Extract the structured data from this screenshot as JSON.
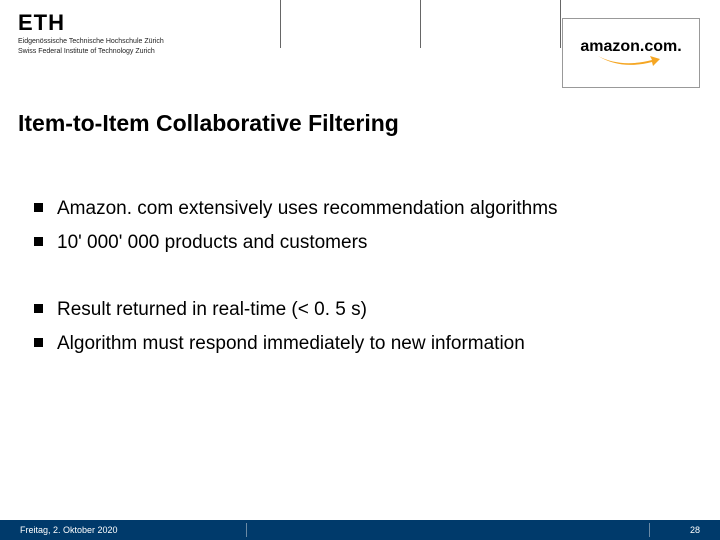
{
  "header": {
    "institution_short": "ETH",
    "institution_line1": "Eidgenössische Technische Hochschule Zürich",
    "institution_line2": "Swiss Federal Institute of Technology Zurich",
    "corner_logo_text": "amazon.com."
  },
  "title": "Item-to-Item Collaborative Filtering",
  "bullets_group1": [
    "Amazon. com extensively uses recommendation algorithms",
    "10' 000' 000 products and customers"
  ],
  "bullets_group2": [
    "Result returned in real-time (< 0. 5 s)",
    "Algorithm must respond immediately to new information"
  ],
  "footer": {
    "date": "Freitag, 2. Oktober 2020",
    "page": "28"
  }
}
